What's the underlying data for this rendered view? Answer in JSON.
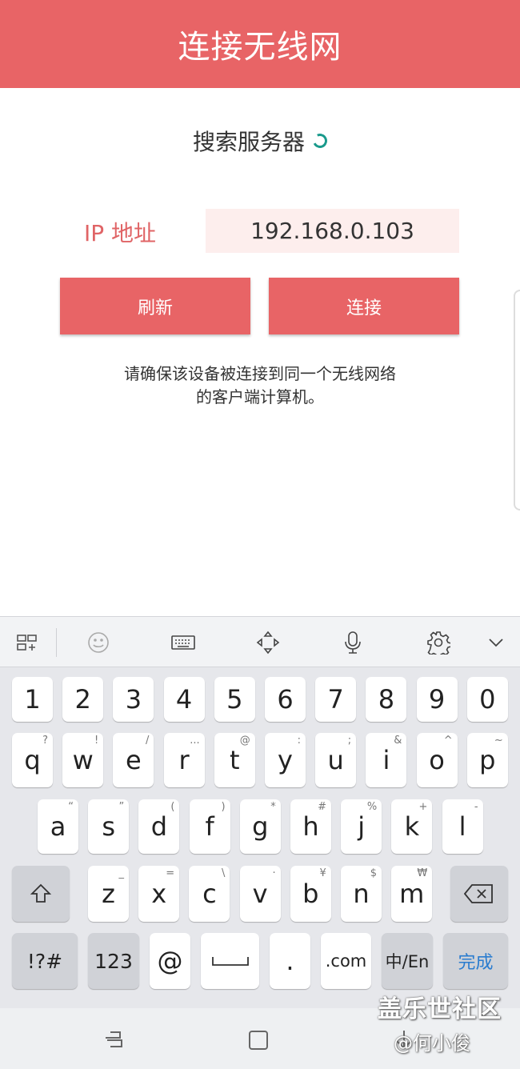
{
  "header": {
    "title": "连接无线网"
  },
  "status": {
    "searching_text": "搜索服务器"
  },
  "ip": {
    "label": "IP 地址",
    "value": "192.168.0.103"
  },
  "buttons": {
    "refresh": "刷新",
    "connect": "连接"
  },
  "note": {
    "line1": "请确保该设备被连接到同一个无线网络",
    "line2": "的客户端计算机。"
  },
  "keyboard": {
    "toolbar_icons": [
      "apps-grid-icon",
      "emoji-icon",
      "keyboard-icon",
      "cursor-move-icon",
      "microphone-icon",
      "gear-icon",
      "chevron-down-icon"
    ],
    "numbers": [
      "1",
      "2",
      "3",
      "4",
      "5",
      "6",
      "7",
      "8",
      "9",
      "0"
    ],
    "row1": [
      {
        "k": "q",
        "s": "?"
      },
      {
        "k": "w",
        "s": "!"
      },
      {
        "k": "e",
        "s": "/"
      },
      {
        "k": "r",
        "s": "..."
      },
      {
        "k": "t",
        "s": "@"
      },
      {
        "k": "y",
        "s": ":"
      },
      {
        "k": "u",
        "s": ";"
      },
      {
        "k": "i",
        "s": "&"
      },
      {
        "k": "o",
        "s": "^"
      },
      {
        "k": "p",
        "s": "~"
      }
    ],
    "row2": [
      {
        "k": "a",
        "s": "“"
      },
      {
        "k": "s",
        "s": "”"
      },
      {
        "k": "d",
        "s": "("
      },
      {
        "k": "f",
        "s": ")"
      },
      {
        "k": "g",
        "s": "*"
      },
      {
        "k": "h",
        "s": "#"
      },
      {
        "k": "j",
        "s": "%"
      },
      {
        "k": "k",
        "s": "+"
      },
      {
        "k": "l",
        "s": "-"
      }
    ],
    "row3": [
      {
        "k": "z",
        "s": "_"
      },
      {
        "k": "x",
        "s": "="
      },
      {
        "k": "c",
        "s": "\\"
      },
      {
        "k": "v",
        "s": "·"
      },
      {
        "k": "b",
        "s": "¥"
      },
      {
        "k": "n",
        "s": "$"
      },
      {
        "k": "m",
        "s": "₩"
      }
    ],
    "bottom": {
      "symbols": "!?#",
      "numbers": "123",
      "at": "@",
      "period": ".",
      "dotcom": ".com",
      "lang": "中/En",
      "done": "完成"
    }
  },
  "overlay": {
    "watermark": "盖乐世社区",
    "author": "@何小俊"
  }
}
